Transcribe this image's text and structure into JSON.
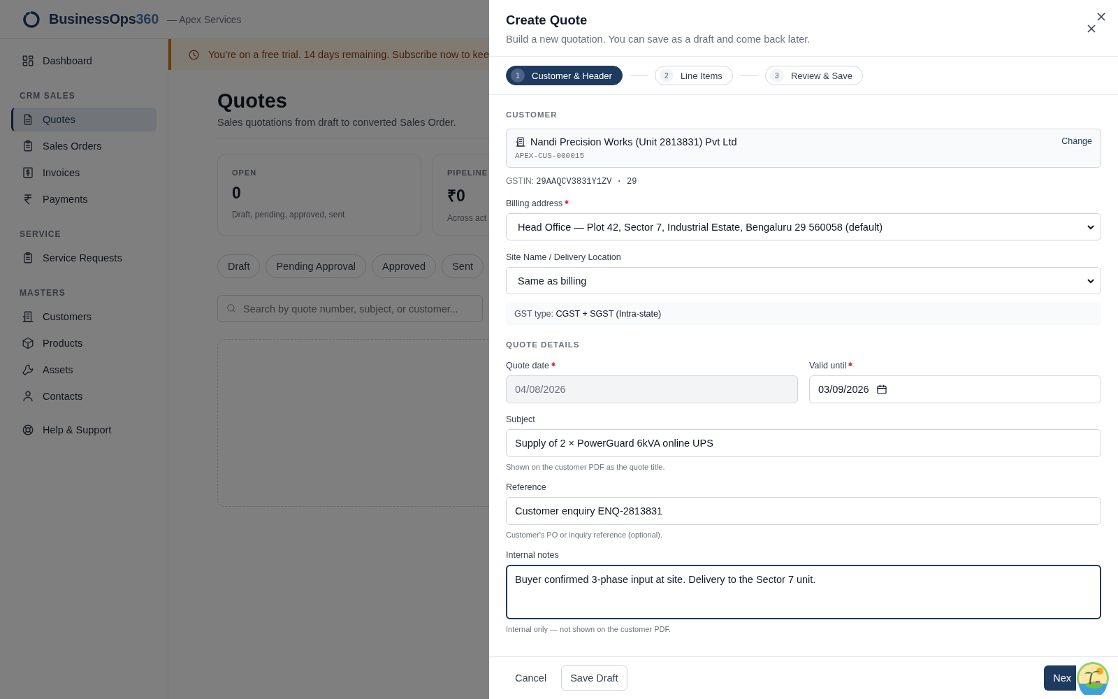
{
  "brand": {
    "name": "BusinessOps",
    "accent": "360",
    "org": "— Apex Services"
  },
  "sidebar": {
    "sections": [
      {
        "items": [
          {
            "label": "Dashboard",
            "selected": false
          }
        ]
      },
      {
        "title": "CRM SALES",
        "items": [
          {
            "label": "Quotes",
            "selected": true
          },
          {
            "label": "Sales Orders",
            "selected": false
          },
          {
            "label": "Invoices",
            "selected": false
          },
          {
            "label": "Payments",
            "selected": false
          }
        ]
      },
      {
        "title": "SERVICE",
        "items": [
          {
            "label": "Service Requests",
            "selected": false
          }
        ]
      },
      {
        "title": "MASTERS",
        "items": [
          {
            "label": "Customers",
            "selected": false
          },
          {
            "label": "Products",
            "selected": false
          },
          {
            "label": "Assets",
            "selected": false
          },
          {
            "label": "Contacts",
            "selected": false
          }
        ]
      },
      {
        "items": [
          {
            "label": "Help & Support",
            "selected": false
          }
        ]
      }
    ]
  },
  "banner": {
    "text": "You're on a free trial. 14 days remaining. Subscribe now to kee"
  },
  "page": {
    "title": "Quotes",
    "subtitle": "Sales quotations from draft to converted Sales Order."
  },
  "stats": [
    {
      "label": "OPEN",
      "value": "0",
      "note": "Draft, pending, approved, sent"
    },
    {
      "label": "PIPELINE",
      "value": "₹0",
      "note": "Across act"
    }
  ],
  "filters": [
    "Draft",
    "Pending Approval",
    "Approved",
    "Sent"
  ],
  "search": {
    "placeholder": "Search by quote number, subject, or customer..."
  },
  "drawer": {
    "title": "Create Quote",
    "subtitle": "Build a new quotation. You can save as a draft and come back later.",
    "steps": [
      {
        "number": "1",
        "label": "Customer & Header",
        "selected": true
      },
      {
        "number": "2",
        "label": "Line Items",
        "selected": false
      },
      {
        "number": "3",
        "label": "Review & Save",
        "selected": false
      }
    ],
    "customer_section": {
      "heading": "CUSTOMER",
      "name": "Nandi Precision Works (Unit 2813831) Pvt Ltd",
      "code": "APEX-CUS-000015",
      "action": "Change",
      "gstin_label": "GSTIN:",
      "gstin": "29AAQCV3831Y1ZV · 29"
    },
    "address_fields": [
      {
        "label": "Billing address",
        "required": true,
        "value": "Head Office — Plot 42, Sector 7, Industrial Estate, Bengaluru 29 560058 (default)"
      },
      {
        "label": "Site Name / Delivery Location",
        "required": false,
        "value": "Same as billing"
      }
    ],
    "gst_note": {
      "label": "GST type:",
      "value": "CGST + SGST (Intra-state)"
    },
    "details_heading": "QUOTE DETAILS",
    "dates": [
      {
        "label": "Quote date",
        "required": true,
        "value": "04/08/2026",
        "disabled": true
      },
      {
        "label": "Valid until",
        "required": true,
        "value": "03/09/2026",
        "disabled": false
      }
    ],
    "fields": [
      {
        "kind": "text",
        "label": "Subject",
        "value": "Supply of 2 × PowerGuard 6kVA online UPS",
        "hint": "Shown on the customer PDF as the quote title.",
        "focused": false
      },
      {
        "kind": "text",
        "label": "Reference",
        "value": "Customer enquiry ENQ-2813831",
        "hint": "Customer's PO or inquiry reference (optional).",
        "focused": false
      },
      {
        "kind": "textarea",
        "label": "Internal notes",
        "value": "Buyer confirmed 3-phase input at site. Delivery to the Sector 7 unit.",
        "hint": "Internal only — not shown on the customer PDF.",
        "focused": true
      }
    ],
    "footer": {
      "cancel": "Cancel",
      "save": "Save Draft",
      "next": "Nex"
    }
  }
}
